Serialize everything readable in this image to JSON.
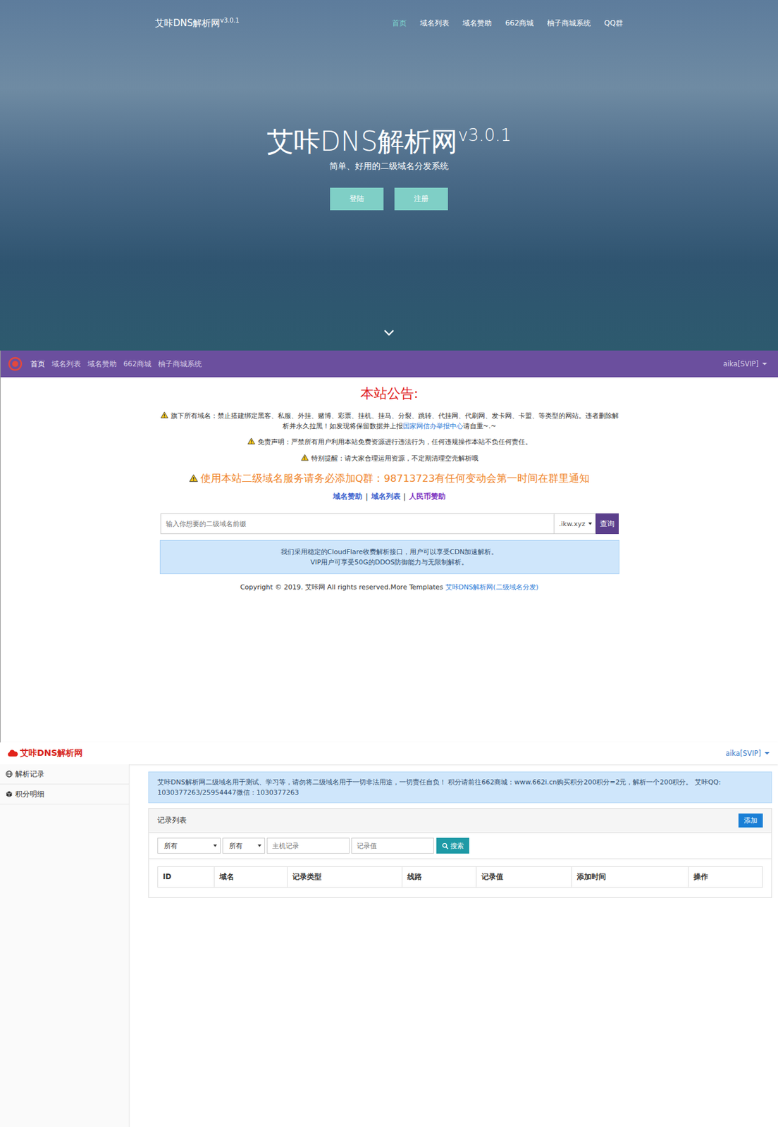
{
  "hero": {
    "logo": "艾咔DNS解析网",
    "logo_version": "v3.0.1",
    "nav": [
      {
        "label": "首页",
        "selected": true
      },
      {
        "label": "域名列表",
        "selected": false
      },
      {
        "label": "域名赞助",
        "selected": false
      },
      {
        "label": "662商城",
        "selected": false
      },
      {
        "label": "柚子商城系统",
        "selected": false
      },
      {
        "label": "QQ群",
        "selected": false
      }
    ],
    "title": "艾咔DNS解析网",
    "version": "v3.0.1",
    "subtitle": "简单、好用的二级域名分发系统",
    "buttons": [
      "登陆",
      "注册"
    ]
  },
  "home": {
    "nav": [
      {
        "label": "首页",
        "selected": true
      },
      {
        "label": "域名列表",
        "selected": false
      },
      {
        "label": "域名赞助",
        "selected": false
      },
      {
        "label": "662商城",
        "selected": false
      },
      {
        "label": "柚子商城系统",
        "selected": false
      }
    ],
    "user": "aika[SVIP]",
    "notice_title": "本站公告:",
    "notices": [
      {
        "text": "旗下所有域名：禁止搭建绑定黑客、私服、外挂、赌博、彩票、挂机、挂马、分裂、跳转、代挂网、代刷网、发卡网、卡盟、等类型的网站。违者删除解析并永久拉黑！如发现将保留数据并上报",
        "link": "国家网信办举报中心",
        "after": "请自重~.~"
      },
      {
        "text": "免责声明：严禁所有用户利用本站免费资源进行违法行为，任何违规操作本站不负任何责任。"
      },
      {
        "text": "特别提醒：请大家合理运用资源，不定期清理空壳解析哦"
      }
    ],
    "highlight": "使用本站二级域名服务请务必添加Q群：98713723有任何变动会第一时间在群里通知",
    "links": [
      {
        "label": "域名赞助",
        "color": "#3a5fcd"
      },
      {
        "label": "域名列表",
        "color": "#3a5fcd"
      },
      {
        "label": "人民币赞助",
        "color": "#7b2fbf"
      }
    ],
    "link_separator": "|",
    "search": {
      "placeholder": "输入你想要的二级域名前缀",
      "suffix": ".ikw.xyz",
      "button": "查询"
    },
    "info": [
      "我们采用稳定的CloudFlare收费解析接口，用户可以享受CDN加速解析。",
      "VIP用户可享受50G的DDOS防御能力与无限制解析。"
    ],
    "copyright": "Copyright © 2019. 艾咔网 All rights reserved.More Templates ",
    "copyright_link": "艾咔DNS解析网(二级域名分发)"
  },
  "panel": {
    "logo": "艾咔DNS解析网",
    "user": "aika[SVIP]",
    "sidebar": [
      {
        "label": "解析记录",
        "selected": false
      },
      {
        "label": "积分明细",
        "selected": false
      }
    ],
    "alert": "艾咔DNS解析网二级域名用于测试、学习等，请勿将二级域名用于一切非法用途，一切责任自负！ 积分请前往662商城：www.662i.cn购买积分200积分=2元，解析一个200积分。 艾咔QQ: 1030377263/25954447微信：1030377263",
    "list_title": "记录列表",
    "add_button": "添加",
    "filters": {
      "select1": "所有",
      "select2": "所有",
      "host_placeholder": "主机记录",
      "value_placeholder": "记录值",
      "search_button": "搜索"
    },
    "columns": [
      "ID",
      "域名",
      "记录类型",
      "线路",
      "记录值",
      "添加时间",
      "操作"
    ]
  }
}
